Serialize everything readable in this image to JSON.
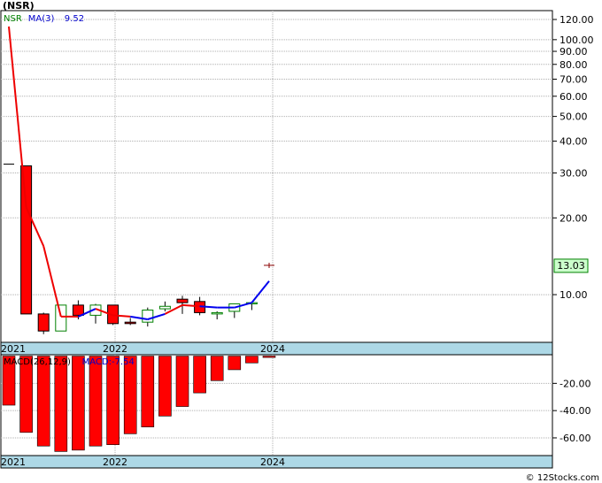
{
  "chart_data": [
    {
      "type": "candlestick",
      "title": "(NSR)",
      "legend": [
        {
          "label": "NSR",
          "color": "#008000"
        },
        {
          "label": "MA(3)",
          "color": "#0000cc"
        },
        {
          "label": "9.52",
          "color": "#0000cc"
        }
      ],
      "scale": "log",
      "ylim": [
        6.5,
        130
      ],
      "yticks": [
        10,
        20,
        30,
        40,
        50,
        60,
        70,
        80,
        90,
        100,
        120
      ],
      "ytick_labels": [
        "10.00",
        "20.00",
        "30.00",
        "40.00",
        "50.00",
        "60.00",
        "70.00",
        "80.00",
        "90.00",
        "100.00",
        "120.00"
      ],
      "xticks": [
        "2021",
        "2022",
        "2024"
      ],
      "current_price": "13.03",
      "candles": [
        {
          "period": 0,
          "open": 32.5,
          "high": 32.5,
          "close": 32.5,
          "low": 32.5
        },
        {
          "period": 1,
          "open": 32,
          "high": 32,
          "close": 8.4,
          "low": 8.4
        },
        {
          "period": 2,
          "open": 8.4,
          "high": 8.5,
          "close": 7.2,
          "low": 7.0
        },
        {
          "period": 3,
          "open": 7.2,
          "high": 9.1,
          "close": 9.1,
          "low": 7.2
        },
        {
          "period": 4,
          "open": 9.1,
          "high": 9.5,
          "close": 8.3,
          "low": 8.0
        },
        {
          "period": 5,
          "open": 8.3,
          "high": 9.2,
          "close": 9.1,
          "low": 7.7
        },
        {
          "period": 6,
          "open": 9.1,
          "high": 9.1,
          "close": 7.7,
          "low": 7.6
        },
        {
          "period": 7,
          "open": 7.8,
          "high": 8.1,
          "close": 7.7,
          "low": 7.6
        },
        {
          "period": 8,
          "open": 7.8,
          "high": 8.9,
          "close": 8.7,
          "low": 7.5
        },
        {
          "period": 9,
          "open": 8.8,
          "high": 9.4,
          "close": 9.0,
          "low": 8.6
        },
        {
          "period": 10,
          "open": 9.6,
          "high": 9.9,
          "close": 9.3,
          "low": 8.4
        },
        {
          "period": 11,
          "open": 9.4,
          "high": 9.8,
          "close": 8.5,
          "low": 8.3
        },
        {
          "period": 12,
          "open": 8.4,
          "high": 8.6,
          "close": 8.5,
          "low": 8.0
        },
        {
          "period": 13,
          "open": 8.6,
          "high": 9.2,
          "close": 9.2,
          "low": 8.1
        },
        {
          "period": 14,
          "open": 9.2,
          "high": 9.3,
          "close": 9.3,
          "low": 8.7
        },
        {
          "period": 15,
          "open": 13.03,
          "high": 13.03,
          "close": 13.03,
          "low": 13.03
        }
      ],
      "ma": [
        {
          "period": 1,
          "value": 22.0,
          "color": "red"
        },
        {
          "period": 2,
          "value": 15.5,
          "color": "red"
        },
        {
          "period": 3,
          "value": 8.2,
          "color": "red"
        },
        {
          "period": 4,
          "value": 8.2,
          "color": "red"
        },
        {
          "period": 5,
          "value": 8.8,
          "color": "blue"
        },
        {
          "period": 6,
          "value": 8.3,
          "color": "red"
        },
        {
          "period": 7,
          "value": 8.2,
          "color": "red"
        },
        {
          "period": 8,
          "value": 8.0,
          "color": "blue"
        },
        {
          "period": 9,
          "value": 8.4,
          "color": "blue"
        },
        {
          "period": 10,
          "value": 9.1,
          "color": "red"
        },
        {
          "period": 11,
          "value": 9.0,
          "color": "red"
        },
        {
          "period": 12,
          "value": 8.9,
          "color": "blue"
        },
        {
          "period": 13,
          "value": 8.9,
          "color": "blue"
        },
        {
          "period": 14,
          "value": 9.3,
          "color": "blue"
        },
        {
          "period": 15,
          "value": 11.3,
          "color": "blue"
        }
      ]
    },
    {
      "type": "bar",
      "legend": [
        {
          "label": "MACD(26,12,9)",
          "color": "#000000"
        },
        {
          "label": "MACD:-7.54",
          "color": "#0000cc"
        }
      ],
      "ylim": [
        -73,
        1
      ],
      "yticks": [
        -20,
        -40,
        -60
      ],
      "ytick_labels": [
        "-20.00",
        "-40.00",
        "-60.00"
      ],
      "xticks": [
        "2021",
        "2022",
        "2024"
      ],
      "values": [
        -36,
        -56,
        -66,
        -70,
        -69,
        -66,
        -65,
        -57,
        -52,
        -44,
        -37,
        -27,
        -18,
        -10,
        -5,
        -1
      ]
    }
  ],
  "footer": {
    "credit": "© 12Stocks.com"
  }
}
